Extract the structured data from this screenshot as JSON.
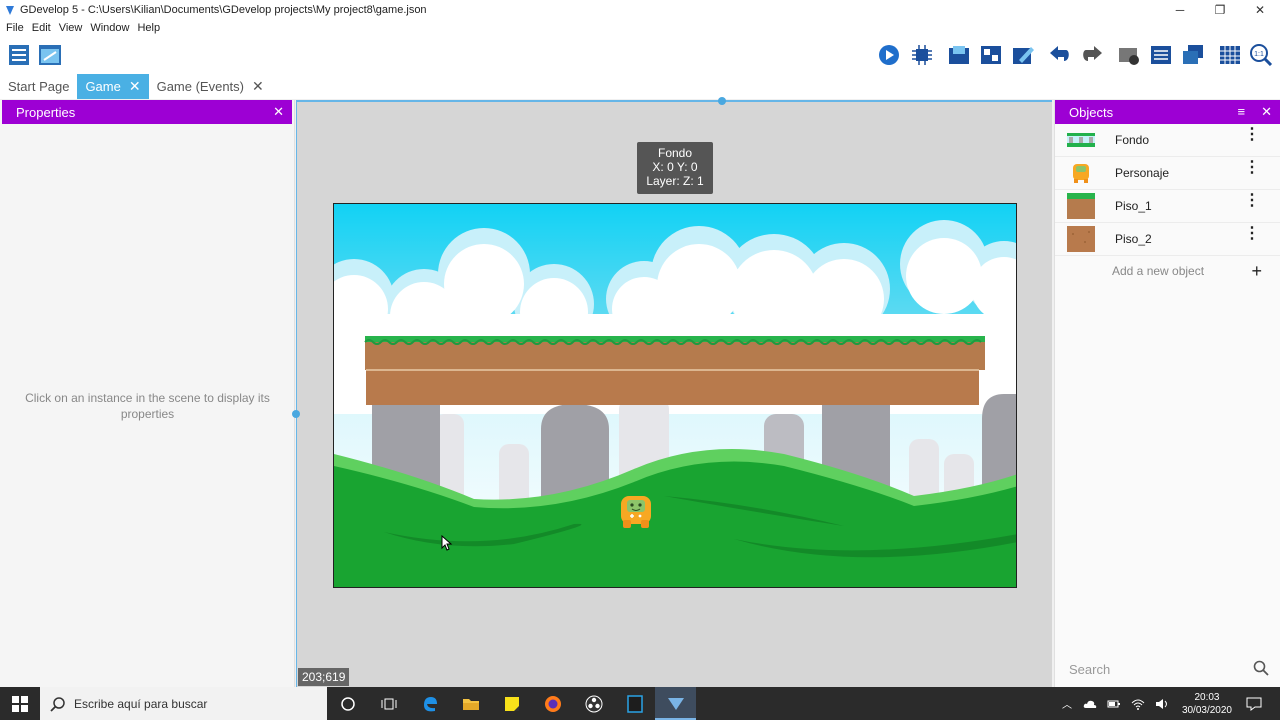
{
  "window": {
    "title": "GDevelop 5 - C:\\Users\\Kilian\\Documents\\GDevelop projects\\My project8\\game.json",
    "minimize": "─",
    "restore": "❐",
    "close": "✕"
  },
  "menu": [
    "File",
    "Edit",
    "View",
    "Window",
    "Help"
  ],
  "tabs": [
    {
      "label": "Start Page",
      "active": false,
      "closable": false
    },
    {
      "label": "Game",
      "active": true,
      "closable": true
    },
    {
      "label": "Game (Events)",
      "active": false,
      "closable": true
    }
  ],
  "tab_close_glyph": "✕",
  "properties": {
    "title": "Properties",
    "close": "✕",
    "hint": "Click on an instance in the scene to display its properties"
  },
  "scene": {
    "tooltip": {
      "name": "Fondo",
      "position": "X: 0  Y: 0",
      "layer": "Layer:   Z: 1"
    },
    "cursor_coords": "203;619"
  },
  "objects_panel": {
    "title": "Objects",
    "close": "✕",
    "filter": "≡",
    "items": [
      {
        "name": "Fondo",
        "thumb": "background-thumbnail"
      },
      {
        "name": "Personaje",
        "thumb": "character-thumbnail"
      },
      {
        "name": "Piso_1",
        "thumb": "grass-tile-thumbnail"
      },
      {
        "name": "Piso_2",
        "thumb": "dirt-tile-thumbnail"
      }
    ],
    "add_label": "Add a new object",
    "add_glyph": "+",
    "more_glyph": "⋮",
    "search_placeholder": "Search"
  },
  "taskbar": {
    "search_placeholder": "Escribe aquí para buscar",
    "time": "20:03",
    "date": "30/03/2020"
  },
  "colors": {
    "accent_purple": "#9d00d4",
    "tab_active": "#4ab0e4",
    "sky": "#1ad4f2",
    "grass": "#22a43a"
  }
}
